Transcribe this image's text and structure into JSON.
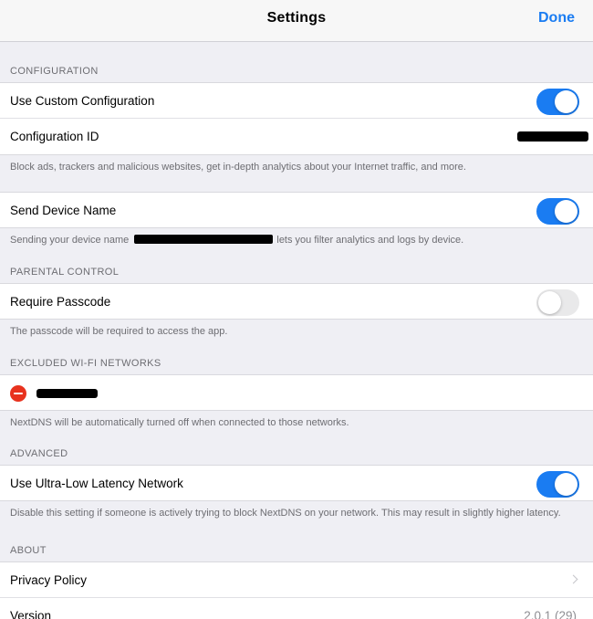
{
  "navbar": {
    "title": "Settings",
    "done_label": "Done"
  },
  "colors": {
    "accent": "#1a7cf2",
    "destructive": "#e8321e",
    "toggle_off": "#e9e9ea"
  },
  "configuration": {
    "header": "CONFIGURATION",
    "use_custom": {
      "label": "Use Custom Configuration",
      "enabled": true
    },
    "config_id": {
      "label": "Configuration ID"
    },
    "footer": "Block ads, trackers and malicious websites, get in-depth analytics about your Internet traffic, and more."
  },
  "device_name": {
    "label": "Send Device Name",
    "enabled": true,
    "footer_before": "Sending your device name",
    "footer_after": "lets you filter analytics and logs by device."
  },
  "parental": {
    "header": "PARENTAL CONTROL",
    "require_passcode": {
      "label": "Require Passcode",
      "enabled": false
    },
    "footer": "The passcode will be required to access the app."
  },
  "excluded": {
    "header": "EXCLUDED WI-FI NETWORKS",
    "footer": "NextDNS will be automatically turned off when connected to those networks."
  },
  "advanced": {
    "header": "ADVANCED",
    "ultra_low": {
      "label": "Use Ultra-Low Latency Network",
      "enabled": true
    },
    "footer": "Disable this setting if someone is actively trying to block NextDNS on your network. This may result in slightly higher latency."
  },
  "about": {
    "header": "ABOUT",
    "privacy": {
      "label": "Privacy Policy"
    },
    "version": {
      "label": "Version",
      "value": "2.0.1 (29)"
    }
  }
}
